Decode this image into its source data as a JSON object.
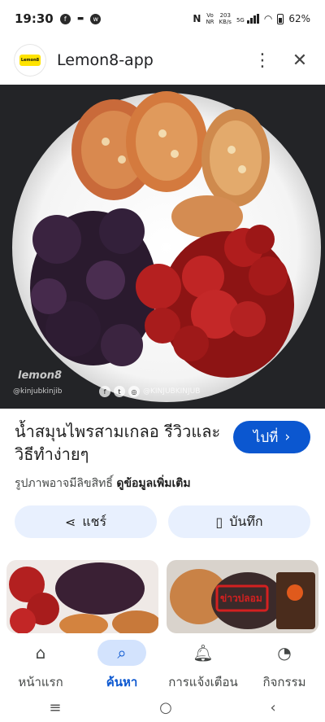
{
  "status_bar": {
    "time": "19:30",
    "net_speed": "203\nKB/s",
    "network_type": "5G",
    "battery": "62%"
  },
  "header": {
    "logo_text": "Lemon8",
    "title": "Lemon8-app",
    "more_icon": "more-vert-icon",
    "close_icon": "close-icon"
  },
  "image": {
    "watermark_logo": "lemon8",
    "watermark_handle": "@kinjubkinjib",
    "watermark_social": "@KINJUBKINJUB"
  },
  "result": {
    "title": "น้ำสมุนไพรสามเกลอ รีวิวและวิธีทำง่ายๆ",
    "visit_label": "ไปที่",
    "rights_text": "รูปภาพอาจมีลิขสิทธิ์",
    "more_info_link": "ดูข้อมูลเพิ่มเติม"
  },
  "actions": {
    "share_label": "แชร์",
    "save_label": "บันทึก"
  },
  "thumbnails": {
    "second_overlay_text": "ข่าวปลอม"
  },
  "bottom_nav": {
    "items": [
      {
        "label": "หน้าแรก",
        "icon": "home-icon"
      },
      {
        "label": "ค้นหา",
        "icon": "search-icon",
        "active": true
      },
      {
        "label": "การแจ้งเตือน",
        "icon": "bell-icon"
      },
      {
        "label": "กิจกรรม",
        "icon": "activity-icon"
      }
    ]
  },
  "colors": {
    "accent": "#0b57d0",
    "pill_bg": "#e8f0fe",
    "active_nav_bg": "#d3e3fd"
  }
}
